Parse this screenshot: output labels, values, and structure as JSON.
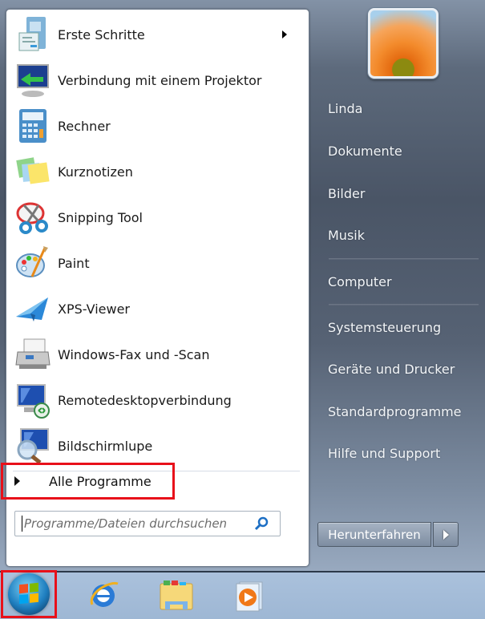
{
  "programs": [
    {
      "label": "Erste Schritte",
      "icon": "getting-started-icon",
      "has_submenu": true
    },
    {
      "label": "Verbindung mit einem Projektor",
      "icon": "projector-icon",
      "has_submenu": false
    },
    {
      "label": "Rechner",
      "icon": "calculator-icon",
      "has_submenu": false
    },
    {
      "label": "Kurznotizen",
      "icon": "sticky-notes-icon",
      "has_submenu": false
    },
    {
      "label": "Snipping Tool",
      "icon": "scissors-icon",
      "has_submenu": false
    },
    {
      "label": "Paint",
      "icon": "paint-palette-icon",
      "has_submenu": false
    },
    {
      "label": "XPS-Viewer",
      "icon": "xps-viewer-icon",
      "has_submenu": false
    },
    {
      "label": "Windows-Fax und -Scan",
      "icon": "fax-scanner-icon",
      "has_submenu": false
    },
    {
      "label": "Remotedesktopverbindung",
      "icon": "remote-desktop-icon",
      "has_submenu": false
    },
    {
      "label": "Bildschirmlupe",
      "icon": "magnifier-icon",
      "has_submenu": false
    }
  ],
  "all_programs": {
    "label": "Alle Programme"
  },
  "search": {
    "placeholder": "Programme/Dateien durchsuchen",
    "value": ""
  },
  "right_panel": {
    "user": "Linda",
    "items": [
      "Dokumente",
      "Bilder",
      "Musik",
      "Computer",
      "Systemsteuerung",
      "Geräte und Drucker",
      "Standardprogramme",
      "Hilfe und Support"
    ]
  },
  "shutdown": {
    "label": "Herunterfahren"
  },
  "taskbar": {
    "pinned": [
      "internet-explorer-icon",
      "windows-explorer-icon",
      "media-player-icon"
    ]
  },
  "highlight_color": "#e8101a"
}
